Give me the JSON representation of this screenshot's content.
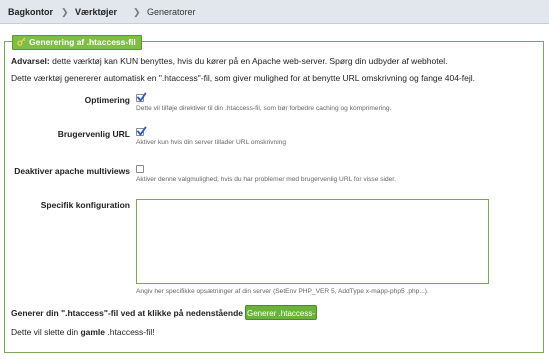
{
  "breadcrumb": {
    "items": [
      "Bagkontor",
      "Værktøjer",
      "Generatorer"
    ],
    "separator": "❯"
  },
  "legend": {
    "label": "Generering af .htaccess-fil",
    "icon": "key-icon"
  },
  "intro": {
    "warning_label": "Advarsel:",
    "warning_text": " dette værktøj kan KUN benyttes, hvis du kører på en Apache web-server. Spørg din udbyder af webhotel.",
    "description": "Dette værktøj genererer automatisk en \".htaccess\"-fil, som giver mulighed for at benytte URL omskrivning og fange 404-fejl."
  },
  "options": [
    {
      "label": "Optimering",
      "checked": true,
      "hint": "Dette vil tilføje direktiver til din .htaccess-fil, som bør forbedre caching og komprimering."
    },
    {
      "label": "Brugervenlig URL",
      "checked": true,
      "hint": "Aktiver kun hvis din server tillader URL omskrivning"
    },
    {
      "label": "Deaktiver apache multiviews",
      "checked": false,
      "hint": "Aktiver denne valgmulighed, hvis du har problemer med brugervenlig URL for visse sider."
    }
  ],
  "specific": {
    "label": "Specifik konfiguration",
    "value": "",
    "hint": "Angiv her specifikke opsætninger af din server (SetEnv PHP_VER 5, AddType x-mapp-php5 .php...)."
  },
  "generate": {
    "prompt": "Generer din \".htaccess\"-fil ved at klikke på nedenstående knap:",
    "button_label": "Generer .htaccess-fil"
  },
  "footer": {
    "prefix": "Dette vil slette din ",
    "bold": "gamle",
    "suffix": " .htaccess-fil!"
  },
  "colors": {
    "accent": "#7fbe45",
    "check": "#2f56c7",
    "breadcrumb_bg": "#e2e7ee"
  }
}
